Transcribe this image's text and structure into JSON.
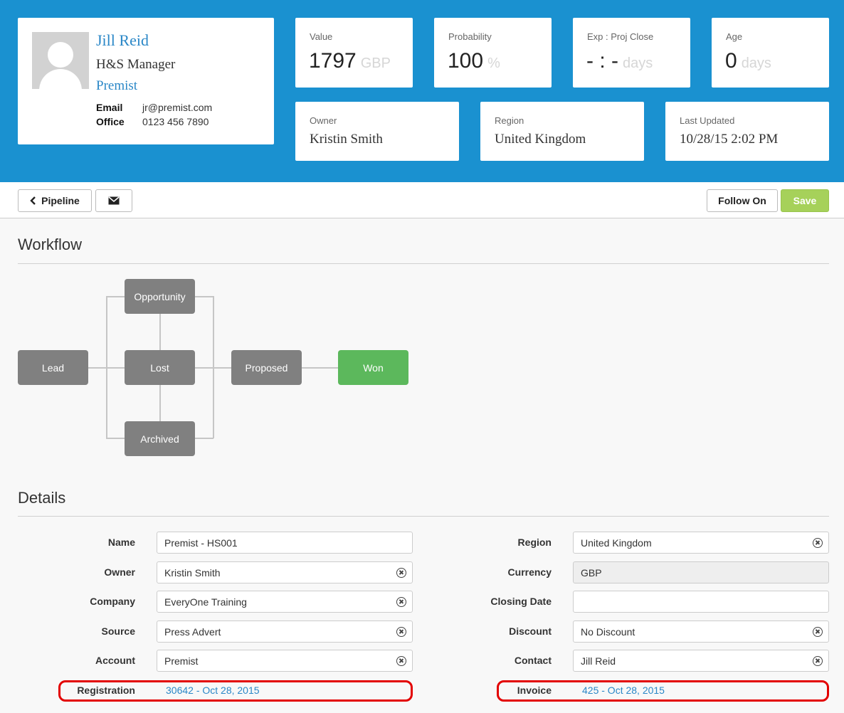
{
  "contact": {
    "name": "Jill Reid",
    "title": "H&S Manager",
    "company": "Premist",
    "email_label": "Email",
    "email": "jr@premist.com",
    "office_label": "Office",
    "office": "0123 456 7890"
  },
  "stats": {
    "value": {
      "label": "Value",
      "number": "1797",
      "unit": "GBP"
    },
    "probability": {
      "label": "Probability",
      "number": "100",
      "unit": "%"
    },
    "exp_close": {
      "label": "Exp : Proj Close",
      "number": "- : -",
      "unit": "days"
    },
    "age": {
      "label": "Age",
      "number": "0",
      "unit": "days"
    },
    "owner": {
      "label": "Owner",
      "value": "Kristin Smith"
    },
    "region": {
      "label": "Region",
      "value": "United Kingdom"
    },
    "last_updated": {
      "label": "Last Updated",
      "value": "10/28/15 2:02 PM"
    }
  },
  "toolbar": {
    "pipeline_label": "Pipeline",
    "follow_on_label": "Follow On",
    "save_label": "Save"
  },
  "workflow": {
    "title": "Workflow",
    "nodes": {
      "lead": "Lead",
      "opportunity": "Opportunity",
      "lost": "Lost",
      "archived": "Archived",
      "proposed": "Proposed",
      "won": "Won"
    }
  },
  "details": {
    "title": "Details",
    "left": {
      "name": {
        "label": "Name",
        "value": "Premist - HS001"
      },
      "owner": {
        "label": "Owner",
        "value": "Kristin Smith"
      },
      "company": {
        "label": "Company",
        "value": "EveryOne Training"
      },
      "source": {
        "label": "Source",
        "value": "Press Advert"
      },
      "account": {
        "label": "Account",
        "value": "Premist"
      },
      "registration": {
        "label": "Registration",
        "value": "30642 - Oct 28, 2015"
      }
    },
    "right": {
      "region": {
        "label": "Region",
        "value": "United Kingdom"
      },
      "currency": {
        "label": "Currency",
        "value": "GBP"
      },
      "closing_date": {
        "label": "Closing Date",
        "value": ""
      },
      "discount": {
        "label": "Discount",
        "value": "No Discount"
      },
      "contact": {
        "label": "Contact",
        "value": "Jill Reid"
      },
      "invoice": {
        "label": "Invoice",
        "value": "425 - Oct 28, 2015"
      }
    }
  },
  "colors": {
    "header_bg": "#1a91d0",
    "link": "#2a87c7",
    "node_default": "#808080",
    "node_won": "#5cb85c",
    "save_button": "#a6d15a",
    "highlight": "#e30000"
  }
}
